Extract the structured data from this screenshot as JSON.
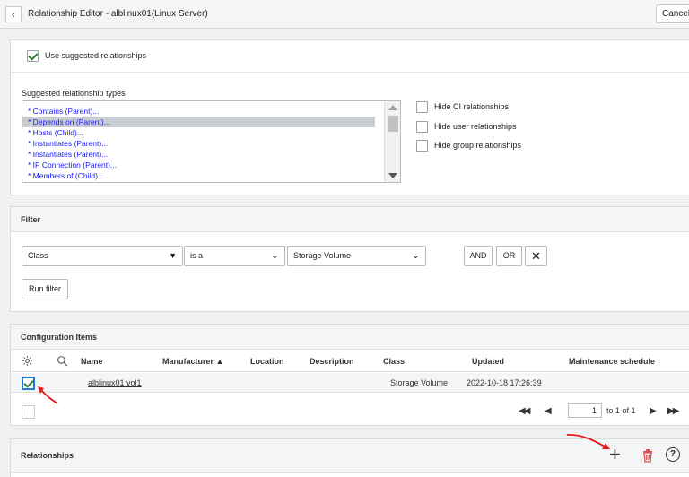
{
  "header": {
    "title": "Relationship Editor - alblinux01(Linux Server)",
    "cancel_label": "Cancel"
  },
  "suggested": {
    "use_label": "Use suggested relationships",
    "types_label": "Suggested relationship types",
    "options": [
      "* Contains (Parent)...",
      "* Depends on (Parent)...",
      "* Hosts (Child)...",
      "* Instantiates (Parent)...",
      "* Instantiates (Parent)...",
      "* IP Connection (Parent)...",
      "* Members of (Child)..."
    ],
    "hide_ci": "Hide CI relationships",
    "hide_user": "Hide user relationships",
    "hide_group": "Hide group relationships"
  },
  "filter": {
    "title": "Filter",
    "field": "Class",
    "operator": "is a",
    "value": "Storage Volume",
    "and_label": "AND",
    "or_label": "OR",
    "remove_label": "✕",
    "run_label": "Run filter"
  },
  "ci": {
    "title": "Configuration Items",
    "columns": {
      "name": "Name",
      "manufacturer": "Manufacturer ▲",
      "location": "Location",
      "description": "Description",
      "class": "Class",
      "updated": "Updated",
      "maintenance": "Maintenance schedule"
    },
    "rows": [
      {
        "name": "alblinux01 vol1",
        "class": "Storage Volume",
        "updated": "2022-10-18 17:26:39"
      }
    ],
    "pagination": {
      "first": "◀◀",
      "prev": "◀",
      "page": "1",
      "of_text": "to 1 of 1",
      "next": "▶",
      "last": "▶▶"
    }
  },
  "relationships": {
    "title": "Relationships",
    "add_label": "+",
    "help_label": "?"
  },
  "colors": {
    "accent_check": "#2e7d32",
    "link": "#1a1aff",
    "annotation": "#e8191a",
    "delete": "#d9534f"
  }
}
